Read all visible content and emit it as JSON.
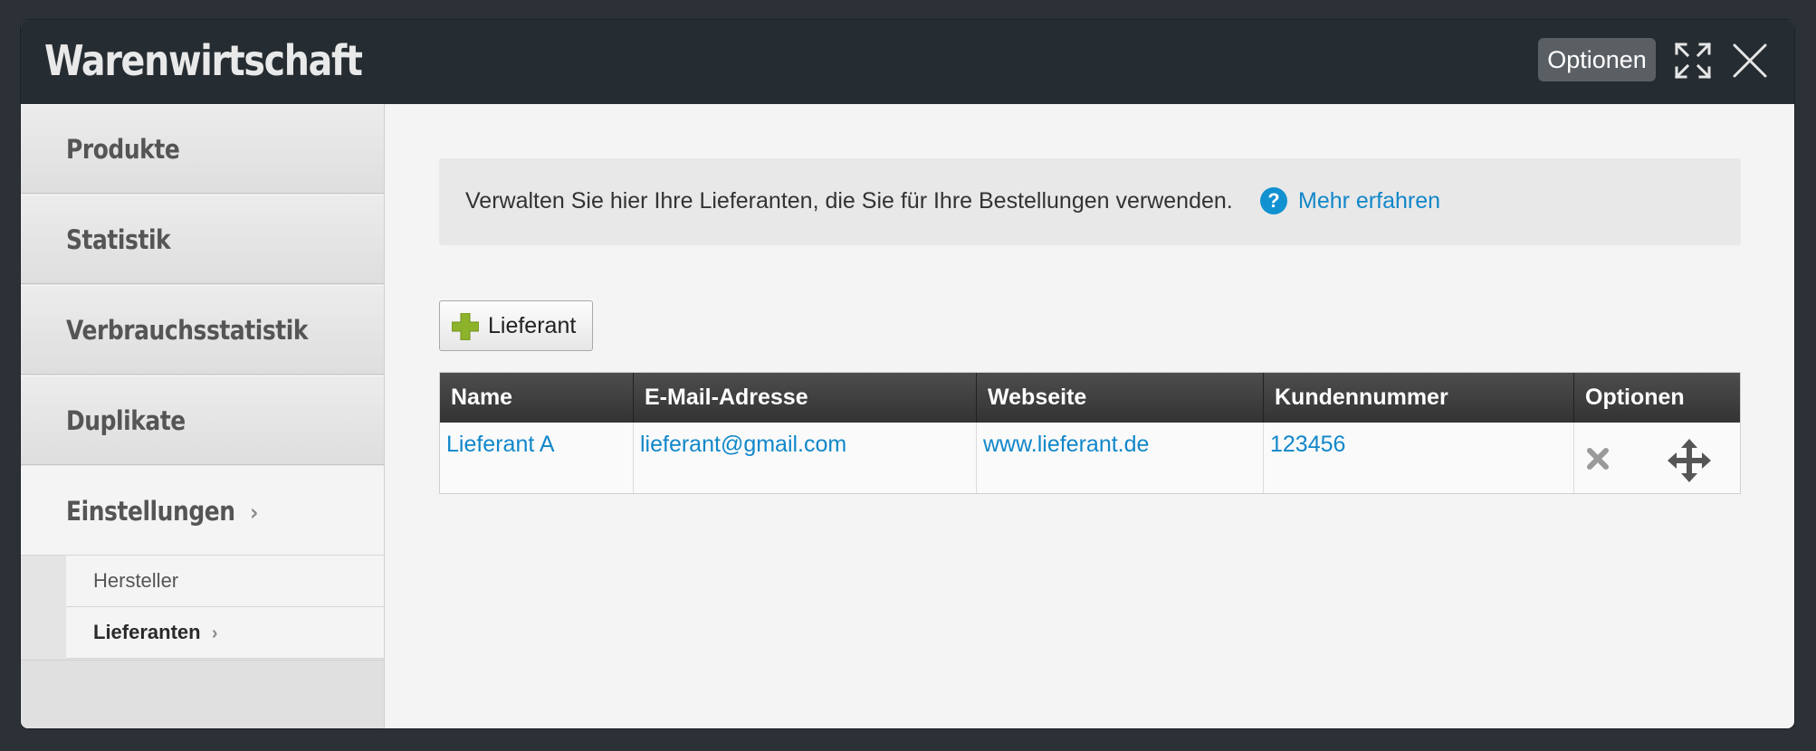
{
  "window": {
    "title": "Warenwirtschaft",
    "options_label": "Optionen",
    "expand_icon": "expand-icon",
    "close_icon": "close-icon"
  },
  "sidebar": {
    "items": [
      {
        "label": "Produkte"
      },
      {
        "label": "Statistik"
      },
      {
        "label": "Verbrauchsstatistik"
      },
      {
        "label": "Duplikate"
      },
      {
        "label": "Einstellungen",
        "chevron": "›"
      }
    ],
    "subitems": [
      {
        "label": "Hersteller"
      },
      {
        "label": "Lieferanten",
        "chevron": "›"
      }
    ]
  },
  "info": {
    "text": "Verwalten Sie hier Ihre Lieferanten, die Sie für Ihre Bestellungen verwenden.",
    "help_glyph": "?",
    "link": "Mehr erfahren"
  },
  "add_button": {
    "label": "Lieferant",
    "icon": "plus-icon"
  },
  "table": {
    "headers": [
      "Name",
      "E-Mail-Adresse",
      "Webseite",
      "Kundennummer",
      "Optionen"
    ],
    "rows": [
      {
        "name": "Lieferant A",
        "email": "lieferant@gmail.com",
        "website": "www.lieferant.de",
        "customer_number": "123456"
      }
    ]
  },
  "colors": {
    "titlebar": "#262d32",
    "link": "#1187c9",
    "help": "#1191d0",
    "plus": "#8db32b"
  }
}
